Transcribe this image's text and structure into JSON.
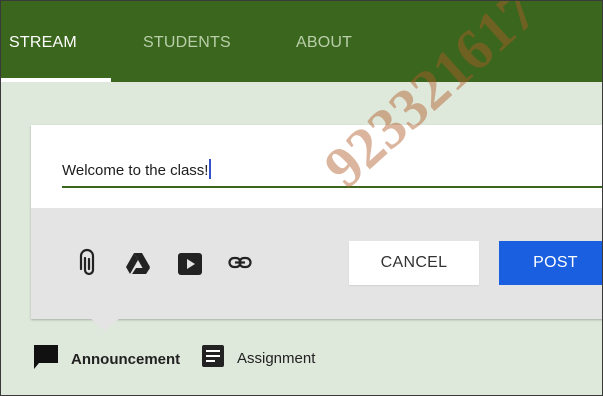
{
  "tabs": [
    {
      "label": "STREAM",
      "active": true
    },
    {
      "label": "STUDENTS",
      "active": false
    },
    {
      "label": "ABOUT",
      "active": false
    }
  ],
  "composer": {
    "text": "Welcome to the class!",
    "attach_icons": [
      "paperclip-icon",
      "google-drive-icon",
      "youtube-icon",
      "link-icon"
    ],
    "cancel_label": "CANCEL",
    "post_label": "POST"
  },
  "post_types": {
    "announcement_label": "Announcement",
    "assignment_label": "Assignment"
  },
  "watermark": "923321617",
  "colors": {
    "header": "#3b661d",
    "page_bg": "#dfe9db",
    "post_button": "#1a5fe0",
    "caret": "#3352c8"
  }
}
